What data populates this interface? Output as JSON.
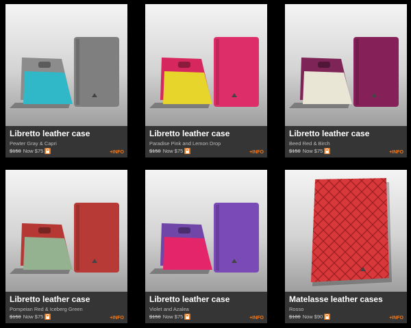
{
  "products": [
    {
      "title": "Libretto leather case",
      "colors": "Pewter Gray & Capri",
      "old_price": "$150",
      "now_price": "Now $75",
      "more_label": "+INFO",
      "front_color": "#8c8c8c",
      "accent_color": "#31b8c8",
      "back_color": "#7f7f7f"
    },
    {
      "title": "Libretto leather case",
      "colors": "Paradise Pink and Lemon Drop",
      "old_price": "$150",
      "now_price": "Now $75",
      "more_label": "+INFO",
      "front_color": "#d6285f",
      "accent_color": "#e8d52b",
      "back_color": "#de2e6a"
    },
    {
      "title": "Libretto leather case",
      "colors": "Beed Red & Birch",
      "old_price": "$150",
      "now_price": "Now $75",
      "more_label": "+INFO",
      "front_color": "#7e2456",
      "accent_color": "#e9e6d6",
      "back_color": "#852158"
    },
    {
      "title": "Libretto leather case",
      "colors": "Pompeian Red & Iceberg Green",
      "old_price": "$150",
      "now_price": "Now $75",
      "more_label": "+INFO",
      "front_color": "#b63835",
      "accent_color": "#94b290",
      "back_color": "#b83a36"
    },
    {
      "title": "Libretto leather case",
      "colors": "Violet and Azalea",
      "old_price": "$150",
      "now_price": "Now $75",
      "more_label": "+INFO",
      "front_color": "#7046a9",
      "accent_color": "#e52569",
      "back_color": "#7a4bb6"
    },
    {
      "title": "Matelasse leather cases",
      "colors": "Rosso",
      "old_price": "$180",
      "now_price": "Now $90",
      "more_label": "+INFO",
      "front_color": "#d8383b",
      "accent_color": "#d8383b",
      "back_color": "#d8383b"
    }
  ]
}
